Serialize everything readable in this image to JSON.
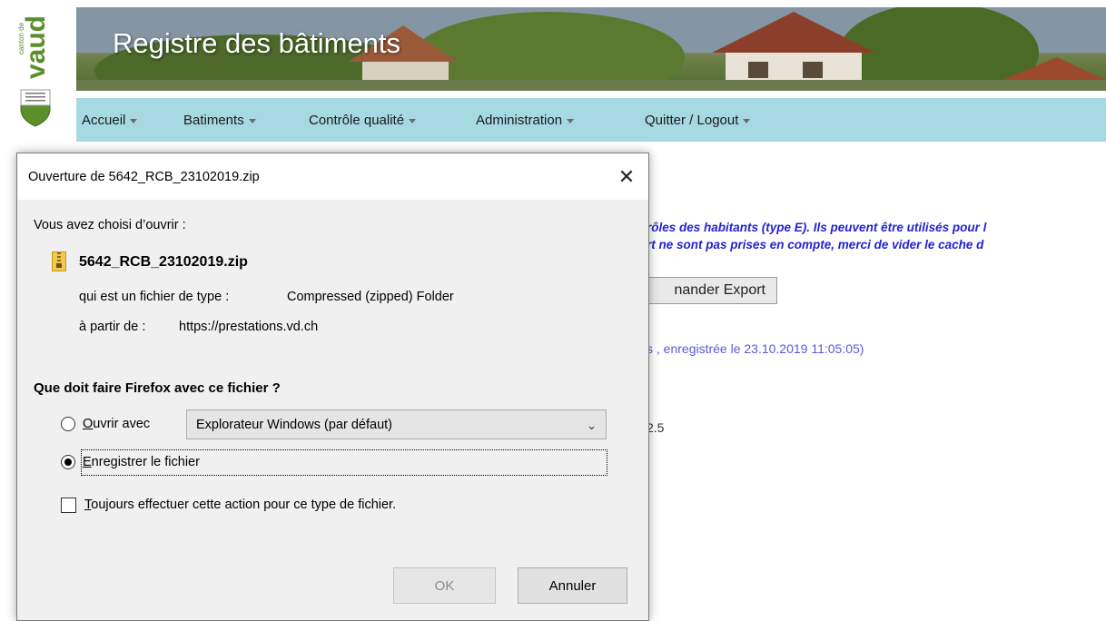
{
  "logo": {
    "canton": "canton de",
    "name": "vaud",
    "motto": "LIBERTÉ ET PATRIE"
  },
  "app": {
    "title": "Registre des bâtiments"
  },
  "nav": [
    {
      "label": "Accueil"
    },
    {
      "label": "Batiments"
    },
    {
      "label": "Contrôle qualité"
    },
    {
      "label": "Administration"
    },
    {
      "label": "Quitter / Logout"
    }
  ],
  "background": {
    "line1": "rôles des habitants (type E). Ils peuvent être utilisés pour l",
    "line2": "rt ne sont pas prises en compte, merci de vider le cache d",
    "button": "nander Export",
    "request_info": "s , enregistrée le 23.10.2019 11:05:05)",
    "version": "2.5"
  },
  "dialog": {
    "title": "Ouverture de 5642_RCB_23102019.zip",
    "close": "✕",
    "intro": "Vous avez choisi d’ouvrir :",
    "filename": "5642_RCB_23102019.zip",
    "type_label": "qui est un fichier de type :",
    "type_value": "Compressed (zipped) Folder",
    "source_label": "à partir de :",
    "source_value": "https://prestations.vd.ch",
    "question": "Que doit faire Firefox avec ce fichier ?",
    "open_with": {
      "accel": "O",
      "rest": "uvrir avec",
      "selected": false
    },
    "app_select": {
      "value": "Explorateur Windows (par défaut)"
    },
    "save_file": {
      "accel": "E",
      "rest": "nregistrer le fichier",
      "selected": true
    },
    "always": {
      "accel": "T",
      "rest": "oujours effectuer cette action pour ce type de fichier.",
      "checked": false
    },
    "ok": "OK",
    "cancel": "Annuler"
  },
  "colors": {
    "nav_bg": "#a7d9e3",
    "logo_green": "#5a8f29",
    "link_blue": "#2323d0"
  }
}
